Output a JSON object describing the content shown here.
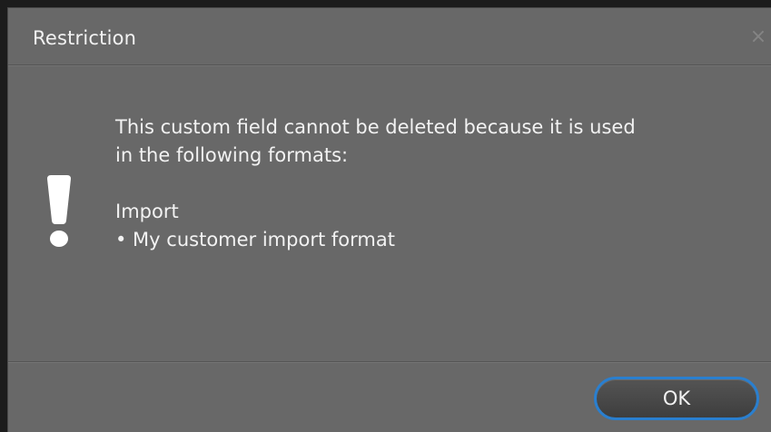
{
  "dialog": {
    "title": "Restriction",
    "close_symbol": "×",
    "icon": "exclamation-icon",
    "message_line_1": "This custom field cannot be deleted because it is used",
    "message_line_2": "in the following formats:",
    "group_heading": "Import",
    "group_item": "• My customer import format",
    "ok_label": "OK"
  },
  "colors": {
    "dialog_background": "#686868",
    "text": "#f2f2f2",
    "button_focus_ring": "#2a7fcf"
  }
}
